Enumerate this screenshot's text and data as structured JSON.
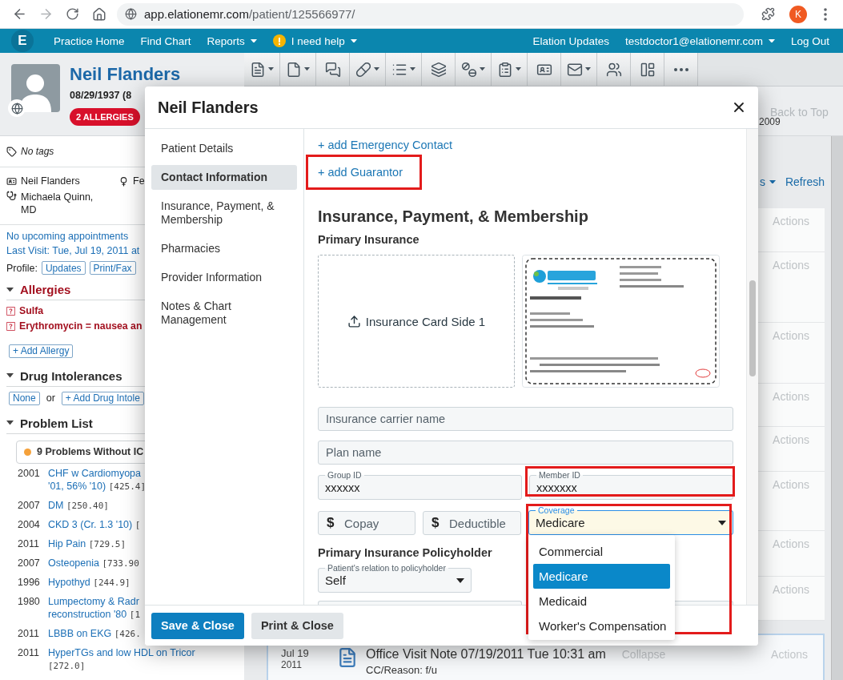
{
  "browser": {
    "url_host": "app.elationemr.com",
    "url_path": "/patient/125566977/",
    "profile_initial": "K"
  },
  "nav": {
    "logo": "E",
    "items": [
      {
        "label": "Practice Home",
        "kind": "link"
      },
      {
        "label": "Find Chart",
        "kind": "link"
      },
      {
        "label": "Reports",
        "kind": "menu"
      },
      {
        "label": "I need help",
        "kind": "help"
      }
    ],
    "right": [
      {
        "label": "Elation Updates",
        "kind": "link"
      },
      {
        "label": "testdoctor1@elationemr.com",
        "kind": "menu"
      },
      {
        "label": "Log Out",
        "kind": "link"
      }
    ]
  },
  "toolbar": [
    {
      "menu": true
    },
    {
      "menu": true
    },
    {
      "menu": false
    },
    {
      "menu": true
    },
    {
      "menu": true
    },
    {
      "menu": false
    },
    {
      "menu": true
    },
    {
      "menu": true
    },
    {
      "menu": false
    },
    {
      "menu": true
    },
    {
      "menu": false
    },
    {
      "menu": false
    },
    {
      "menu": false
    }
  ],
  "patient_header": {
    "name": "Neil Flanders",
    "dob": "08/29/1937 (8",
    "allergy_badge": "2 ALLERGIES"
  },
  "chart_info": {
    "tags": "No tags",
    "patient": "Neil Flanders",
    "sex": "Fe",
    "provider": "Michaela Quinn, MD"
  },
  "visits": {
    "appointments": "No upcoming appointments",
    "last_visit": "Last Visit: Tue, Jul 19, 2011 at",
    "profile_label": "Profile:",
    "profile_buttons": [
      "Updates",
      "Print/Fax"
    ]
  },
  "allergies": {
    "title": "Allergies",
    "expanded": true,
    "items": [
      "Sulfa",
      "Erythromycin = nausea an"
    ],
    "add_button": "+ Add Allergy"
  },
  "drug_intolerances": {
    "title": "Drug Intolerances",
    "expanded": true,
    "none_button": "None",
    "or": "or",
    "add_button": "+ Add Drug Intole"
  },
  "problem_list": {
    "title": "Problem List",
    "expanded": true,
    "alert": "9 Problems Without IC",
    "items": [
      {
        "year": "2001",
        "lines": [
          "CHF w Cardiomyopa",
          "'01, 56% '10)"
        ],
        "code": "[425.4]"
      },
      {
        "year": "2007",
        "lines": [
          "DM"
        ],
        "code": "[250.40]"
      },
      {
        "year": "2004",
        "lines": [
          "CKD 3 (Cr. 1.3 '10)"
        ],
        "code": "["
      },
      {
        "year": "2011",
        "lines": [
          "Hip Pain"
        ],
        "code": "[729.5]"
      },
      {
        "year": "2007",
        "lines": [
          "Osteopenia"
        ],
        "code": "[733.90"
      },
      {
        "year": "1996",
        "lines": [
          "Hypothyd"
        ],
        "code": "[244.9]"
      },
      {
        "year": "1980",
        "lines": [
          "Lumpectomy & Radr",
          "reconstruction '80"
        ],
        "code": "[1"
      },
      {
        "year": "2011",
        "lines": [
          "LBBB on EKG"
        ],
        "code": "[426."
      },
      {
        "year": "2011",
        "lines": [
          "HyperTGs and low HDL on Tricor"
        ],
        "code": "[272.0]"
      }
    ]
  },
  "page_right": {
    "back_to_top": "Back to Top",
    "year": "2009",
    "filter": "s",
    "refresh": "Refresh",
    "rows": [
      "Actions",
      "Actions",
      "Actions",
      "Actions",
      "Actions",
      "Actions",
      "Actions",
      "Actions"
    ]
  },
  "note_card": {
    "date": "Jul 19",
    "year": "2011",
    "title": "Office Visit Note 07/19/2011 Tue 10:31 am",
    "collapse": "Collapse",
    "action": "Actions",
    "reason": "CC/Reason: f/u"
  },
  "dialog": {
    "title": "Neil Flanders",
    "sections": [
      {
        "label": "Patient Details",
        "selected": false
      },
      {
        "label": "Contact Information",
        "selected": true
      },
      {
        "label": "Insurance, Payment, & Membership",
        "selected": false
      },
      {
        "label": "Pharmacies",
        "selected": false
      },
      {
        "label": "Provider Information",
        "selected": false
      },
      {
        "label": "Notes & Chart Management",
        "selected": false
      }
    ],
    "links": [
      {
        "label": "+ add Emergency Contact",
        "highlighted": false
      },
      {
        "label": "+ add Guarantor",
        "highlighted": true
      }
    ],
    "heading": "Insurance, Payment, & Membership",
    "subheading": "Primary Insurance",
    "upload": "Insurance Card Side 1",
    "carrier": {
      "placeholder": "Insurance carrier name"
    },
    "plan": {
      "placeholder": "Plan name"
    },
    "group_id": {
      "label": "Group ID",
      "value": "xxxxxx",
      "highlighted": false
    },
    "member_id": {
      "label": "Member ID",
      "value": "xxxxxxx",
      "highlighted": true
    },
    "copay": {
      "prefix": "$",
      "placeholder": "Copay"
    },
    "deductible": {
      "prefix": "$",
      "placeholder": "Deductible"
    },
    "coverage": {
      "label": "Coverage",
      "value": "Medicare",
      "focused": true,
      "expanded": true,
      "highlighted": true,
      "options": [
        {
          "label": "Commercial",
          "selected": false
        },
        {
          "label": "Medicare",
          "selected": true
        },
        {
          "label": "Medicaid",
          "selected": false
        },
        {
          "label": "Worker's Compensation",
          "selected": false
        }
      ]
    },
    "policyholder_heading": "Primary Insurance Policyholder",
    "relation": {
      "label": "Patient's relation to policyholder",
      "value": "Self"
    },
    "buttons": [
      {
        "label": "Save & Close",
        "kind": "primary"
      },
      {
        "label": "Print & Close",
        "kind": "secondary"
      }
    ]
  }
}
